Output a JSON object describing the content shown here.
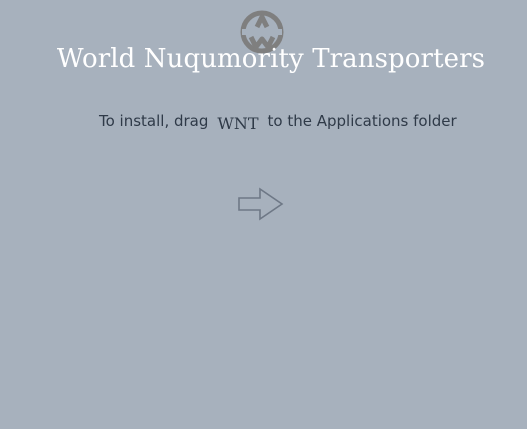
{
  "window": {
    "background": "#a7b1bd"
  },
  "logo": {
    "icon": "wnt-logo-icon",
    "color": "#7f7f7f"
  },
  "header": {
    "title": "World Nuqumority Transporters"
  },
  "instruction": {
    "prefix": "To install, drag",
    "app_name": "WNT",
    "suffix": "to the Applications folder"
  },
  "drag_target": {
    "icon": "right-arrow-icon",
    "color": "#6e7886"
  }
}
